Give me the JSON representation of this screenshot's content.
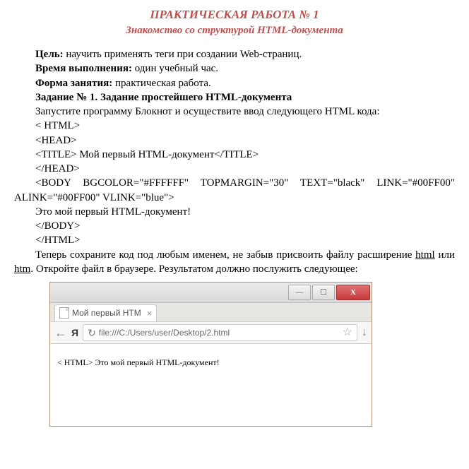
{
  "title": {
    "main": "ПРАКТИЧЕСКАЯ РАБОТА № 1",
    "sub": "Знакомство со структурой HTML-документа"
  },
  "labels": {
    "goal": "Цель: ",
    "time": "Время выполнения: ",
    "form": "Форма занятия: ",
    "task": "Задание № 1. Задание простейшего HTML-документа"
  },
  "text": {
    "goal": "научить применять теги при создании Web-страниц.",
    "time": "один учебный час.",
    "form": "практическая работа.",
    "instr1": "Запустите программу Блокнот и осуществите ввод следующего HTML кода:"
  },
  "code": {
    "l1": "< HTML>",
    "l2": "<HEAD>",
    "l3": "<TITLE> Мой первый HTML-документ</TITLE>",
    "l4": "</HEAD>",
    "l5": "<BODY BGCOLOR=\"#FFFFFF\" TOPMARGIN=\"30\" TEXT=\"black\" LINK=\"#00FF00\" ALINK=\"#00FF00\" VLINK=\"blue\">",
    "l6": "Это мой первый HTML-документ!",
    "l7": "</BODY>",
    "l8": "</HTML>"
  },
  "post": {
    "p1a": "Теперь сохраните код под любым именем, не забыв присвоить файлу расширение ",
    "p1b": "html",
    "p1c": " или ",
    "p1d": "htm",
    "p1e": ". Откройте файл в браузере. Результатом должно послужить следующее:"
  },
  "browser": {
    "tab_title": "Мой первый HTM",
    "ya": "Я",
    "refresh": "↻",
    "url": "file:///C:/Users/user/Desktop/2.html",
    "content": "< HTML> Это мой первый HTML-документ!",
    "min": "—",
    "max": "☐",
    "close": "X"
  }
}
